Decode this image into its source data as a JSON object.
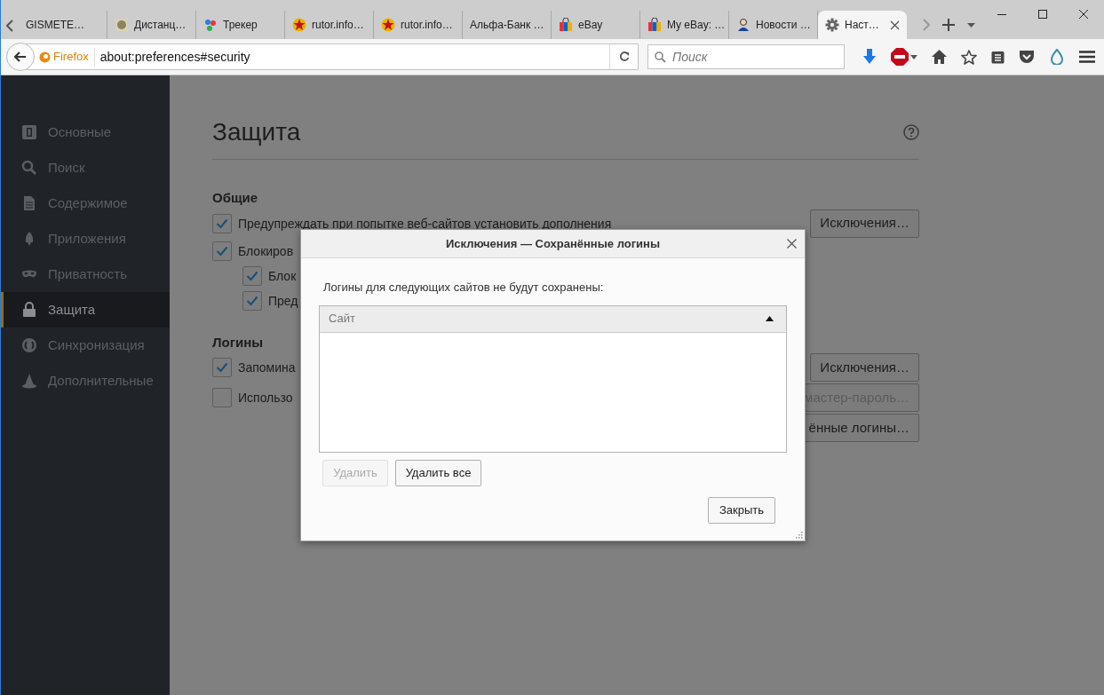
{
  "tabs": [
    {
      "label": "GISMETE…",
      "selected": false
    },
    {
      "label": "Дистанц…",
      "selected": false
    },
    {
      "label": "Трекер",
      "selected": false
    },
    {
      "label": "rutor.info…",
      "selected": false
    },
    {
      "label": "rutor.info…",
      "selected": false
    },
    {
      "label": "Альфа-Банк …",
      "selected": false
    },
    {
      "label": "eBay",
      "selected": false
    },
    {
      "label": "My eBay: …",
      "selected": false
    },
    {
      "label": "Новости …",
      "selected": false
    },
    {
      "label": "Наст…",
      "selected": true
    }
  ],
  "toolbar": {
    "identity": "Firefox",
    "url": "about:preferences#security",
    "search_placeholder": "Поиск"
  },
  "sidebar": {
    "items": [
      {
        "label": "Основные",
        "selected": false
      },
      {
        "label": "Поиск",
        "selected": false
      },
      {
        "label": "Содержимое",
        "selected": false
      },
      {
        "label": "Приложения",
        "selected": false
      },
      {
        "label": "Приватность",
        "selected": false
      },
      {
        "label": "Защита",
        "selected": true
      },
      {
        "label": "Синхронизация",
        "selected": false
      },
      {
        "label": "Дополнительные",
        "selected": false
      }
    ]
  },
  "page": {
    "title": "Защита",
    "sections": [
      {
        "heading": "Общие",
        "rows": [
          {
            "kind": "checkbox",
            "label": "Предупреждать при попытке веб-сайтов установить дополнения",
            "checked": true,
            "button": {
              "label": "Исключения…",
              "disabled": false
            }
          },
          {
            "kind": "checkbox",
            "label": "Блокиров",
            "checked": true,
            "children": [
              {
                "kind": "checkbox",
                "label": "Блок",
                "checked": true
              },
              {
                "kind": "checkbox",
                "label": "Пред",
                "checked": true
              }
            ]
          }
        ]
      },
      {
        "heading": "Логины",
        "rows": [
          {
            "kind": "checkbox",
            "label": "Запомина",
            "checked": true,
            "button": {
              "label": "Исключения…",
              "disabled": false
            }
          },
          {
            "kind": "checkbox",
            "label": "Использо",
            "checked": false,
            "button": {
              "label": "мастер-пароль…",
              "disabled": true
            }
          },
          {
            "kind": "button",
            "button": {
              "label": "ённые логины…",
              "disabled": false
            }
          }
        ]
      }
    ]
  },
  "dialog": {
    "title": "Исключения — Сохранённые логины",
    "description": "Логины для следующих сайтов не будут сохранены:",
    "table": {
      "columns": [
        {
          "label": "Сайт",
          "sorted": true
        }
      ]
    },
    "buttons": [
      {
        "label": "Удалить",
        "disabled": true
      },
      {
        "label": "Удалить все",
        "disabled": false
      }
    ],
    "close_button": "Закрыть"
  }
}
